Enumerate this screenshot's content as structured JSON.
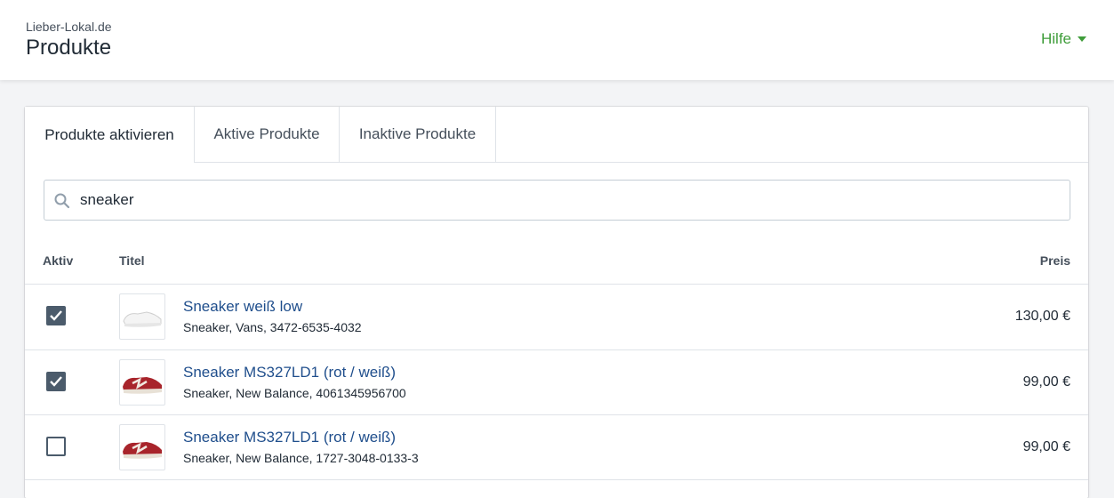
{
  "header": {
    "shop_name": "Lieber-Lokal.de",
    "page_title": "Produkte",
    "help_label": "Hilfe"
  },
  "tabs": [
    {
      "label": "Produkte aktivieren",
      "active": true
    },
    {
      "label": "Aktive Produkte",
      "active": false
    },
    {
      "label": "Inaktive Produkte",
      "active": false
    }
  ],
  "search": {
    "value": "sneaker",
    "icon": "search-icon"
  },
  "table": {
    "columns": {
      "active": "Aktiv",
      "title": "Titel",
      "price": "Preis"
    },
    "rows": [
      {
        "active": true,
        "title": "Sneaker weiß low",
        "meta": "Sneaker, Vans, 3472-6535-4032",
        "price": "130,00 €",
        "thumb": "white-sneaker-image"
      },
      {
        "active": true,
        "title": "Sneaker MS327LD1 (rot / weiß)",
        "meta": "Sneaker, New Balance, 4061345956700",
        "price": "99,00 €",
        "thumb": "red-sneaker-image"
      },
      {
        "active": false,
        "title": "Sneaker MS327LD1 (rot / weiß)",
        "meta": "Sneaker, New Balance, 1727-3048-0133-3",
        "price": "99,00 €",
        "thumb": "red-sneaker-image"
      }
    ]
  },
  "colors": {
    "accent_green": "#3f9d3a",
    "link_blue": "#1f4e8c",
    "checkbox": "#4b5b6b"
  }
}
